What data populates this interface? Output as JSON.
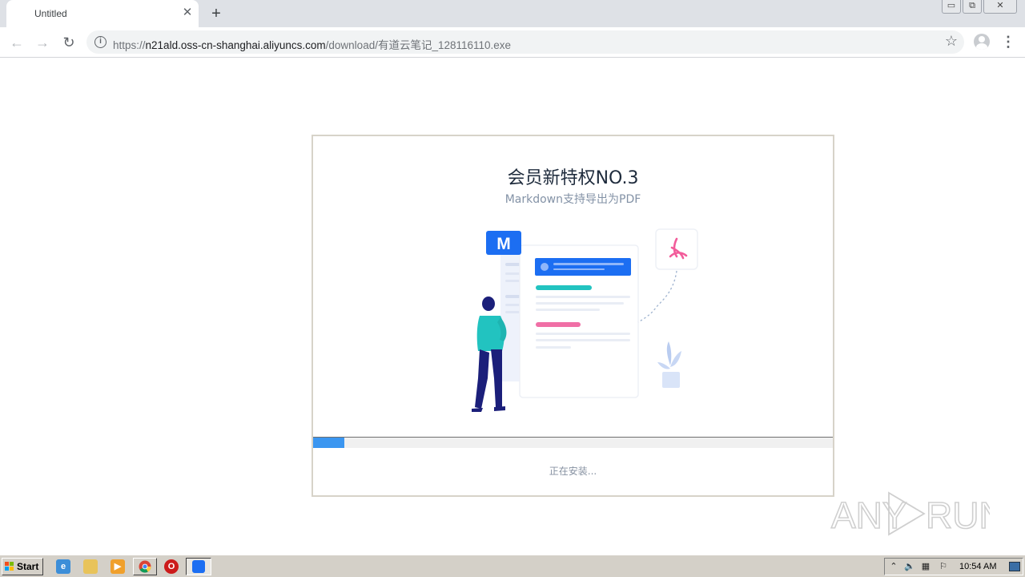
{
  "browser": {
    "tab_title": "Untitled",
    "tab_close": "✕",
    "new_tab": "+",
    "window_buttons": {
      "minimize": "▭",
      "restore": "⧉",
      "close": "✕"
    },
    "nav": {
      "back": "←",
      "forward": "→",
      "reload": "↻"
    },
    "url": {
      "scheme": "https://",
      "host": "n21ald.oss-cn-shanghai.aliyuncs.com",
      "path": "/download/有道云笔记_128116110.exe"
    },
    "info_icon": "i",
    "bookmark_star": "☆",
    "menu": "⋮"
  },
  "installer": {
    "title": "会员新特权NO.3",
    "subtitle": "Markdown支持导出为PDF",
    "illustration": {
      "markdown_badge": "M",
      "pdf_icon": "pdf-icon"
    },
    "progress": 0.06,
    "status": "正在安装..."
  },
  "watermark": {
    "text_left": "ANY",
    "text_right": "RUN"
  },
  "taskbar": {
    "start_label": "Start",
    "quicklaunch": [
      "ie-icon",
      "folder-icon",
      "media-player-icon",
      "chrome-icon",
      "opera-icon",
      "installer-task-icon"
    ],
    "clock": "10:54 AM"
  },
  "colors": {
    "accent_blue": "#3b96f0",
    "markdown_blue": "#1c6ef2",
    "pdf_pink": "#f25c9a",
    "teal": "#22c3c0",
    "figure_navy": "#1b1f7a"
  }
}
